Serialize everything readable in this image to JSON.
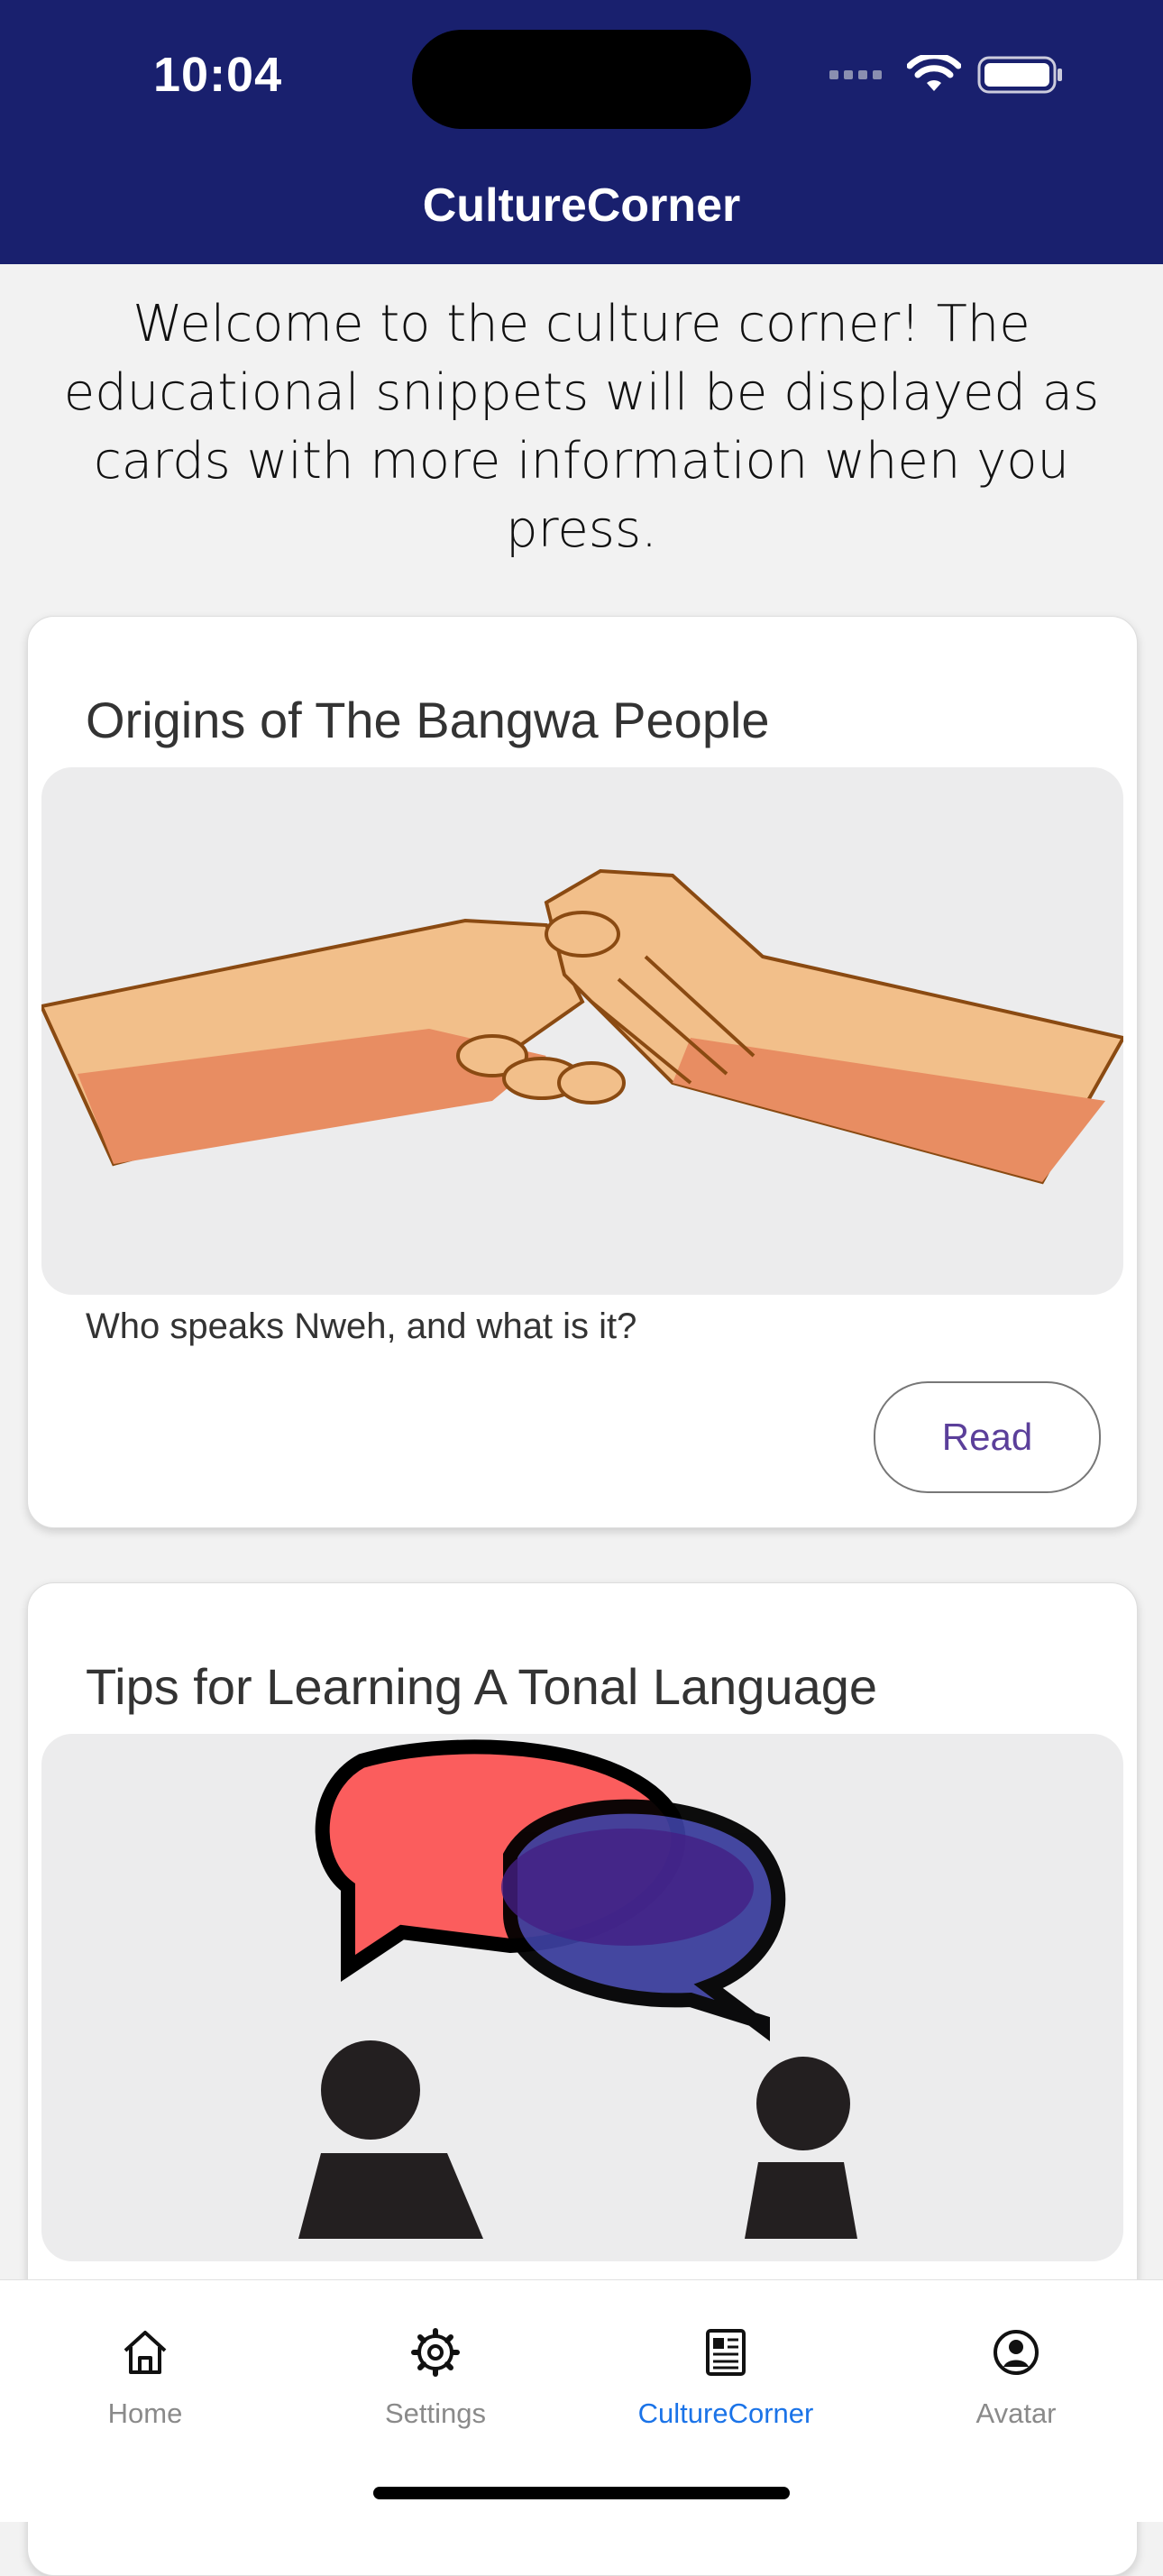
{
  "status_bar": {
    "time": "10:04"
  },
  "header": {
    "title": "CultureCorner"
  },
  "intro_text": "Welcome to the culture corner! The educational snippets will be displayed as cards with more information when you press.",
  "cards": [
    {
      "title": "Origins of The Bangwa People",
      "image_icon": "handshake-illustration",
      "description": "Who speaks Nweh, and what is it?",
      "button_label": "Read"
    },
    {
      "title": "Tips for Learning A Tonal Language",
      "image_icon": "conversation-illustration"
    }
  ],
  "tab_bar": {
    "active": "CultureCorner",
    "tabs": [
      {
        "label": "Home",
        "icon": "home-icon"
      },
      {
        "label": "Settings",
        "icon": "gear-icon"
      },
      {
        "label": "CultureCorner",
        "icon": "newspaper-icon"
      },
      {
        "label": "Avatar",
        "icon": "avatar-icon"
      }
    ]
  },
  "colors": {
    "header_bg": "#19206e",
    "accent": "#1a73e8",
    "button_text": "#5b3f9a"
  }
}
